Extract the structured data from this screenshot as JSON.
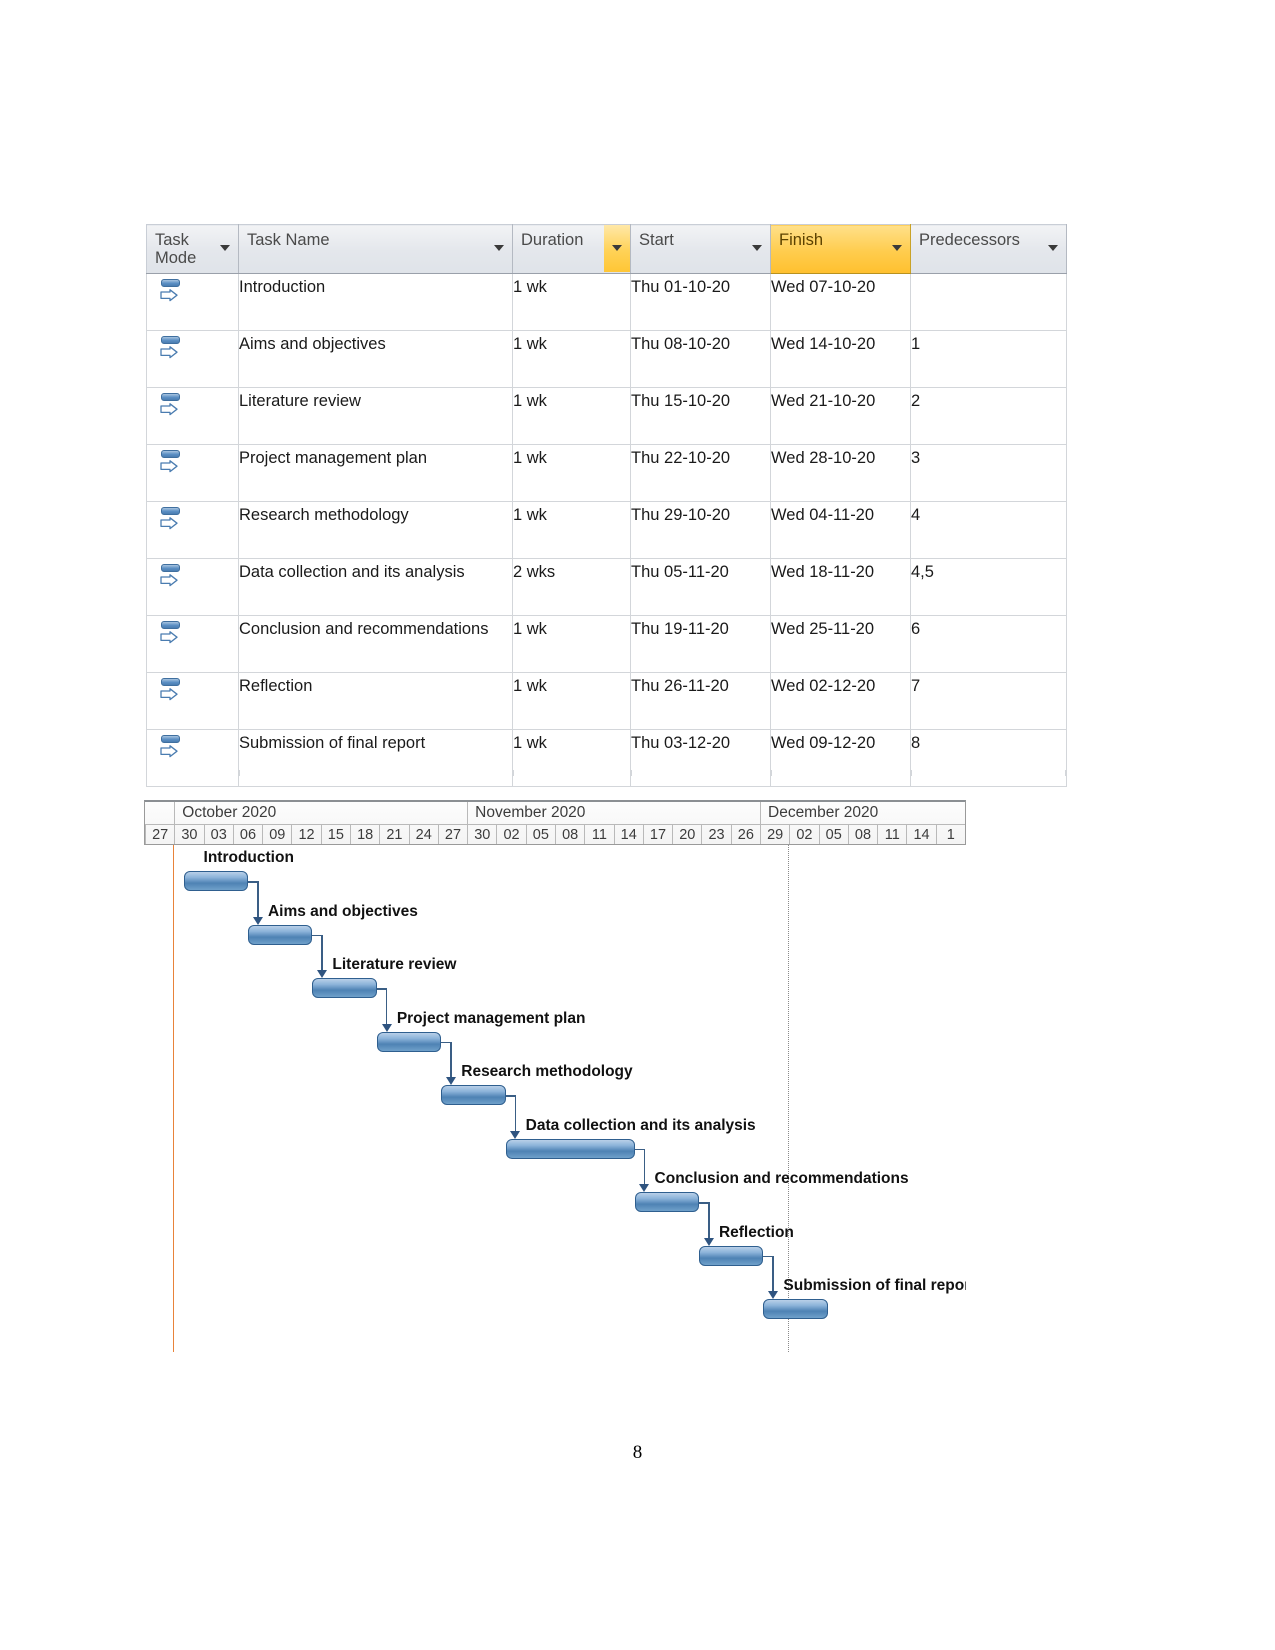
{
  "table": {
    "columns": [
      {
        "key": "mode",
        "label": "Task\nMode",
        "highlight": "none"
      },
      {
        "key": "name",
        "label": "Task Name",
        "highlight": "none"
      },
      {
        "key": "dur",
        "label": "Duration",
        "highlight": "button"
      },
      {
        "key": "start",
        "label": "Start",
        "highlight": "none"
      },
      {
        "key": "finish",
        "label": "Finish",
        "highlight": "full"
      },
      {
        "key": "pred",
        "label": "Predecessors",
        "highlight": "none"
      }
    ],
    "filter_icon": "chevron-down-icon",
    "mode_icon": "auto-scheduled-icon",
    "rows": [
      {
        "name": "Introduction",
        "dur": "1 wk",
        "start": "Thu 01-10-20",
        "finish": "Wed 07-10-20",
        "pred": ""
      },
      {
        "name": "Aims and objectives",
        "dur": "1 wk",
        "start": "Thu 08-10-20",
        "finish": "Wed 14-10-20",
        "pred": "1"
      },
      {
        "name": "Literature review",
        "dur": "1 wk",
        "start": "Thu 15-10-20",
        "finish": "Wed 21-10-20",
        "pred": "2"
      },
      {
        "name": "Project management plan",
        "dur": "1 wk",
        "start": "Thu 22-10-20",
        "finish": "Wed 28-10-20",
        "pred": "3"
      },
      {
        "name": "Research methodology",
        "dur": "1 wk",
        "start": "Thu 29-10-20",
        "finish": "Wed 04-11-20",
        "pred": "4"
      },
      {
        "name": "Data collection and its analysis",
        "dur": "2 wks",
        "start": "Thu 05-11-20",
        "finish": "Wed 18-11-20",
        "pred": "4,5"
      },
      {
        "name": "Conclusion and recommendations",
        "dur": "1 wk",
        "start": "Thu 19-11-20",
        "finish": "Wed 25-11-20",
        "pred": "6"
      },
      {
        "name": "Reflection",
        "dur": "1 wk",
        "start": "Thu 26-11-20",
        "finish": "Wed 02-12-20",
        "pred": "7"
      },
      {
        "name": "Submission of final report",
        "dur": "1 wk",
        "start": "Thu 03-12-20",
        "finish": "Wed 09-12-20",
        "pred": "8"
      }
    ]
  },
  "gantt": {
    "months": [
      {
        "label": "October 2020",
        "start_tick": 1,
        "span": 10
      },
      {
        "label": "November 2020",
        "start_tick": 11,
        "span": 10
      },
      {
        "label": "December 2020",
        "start_tick": 21,
        "span": 5
      }
    ],
    "day_ticks": [
      "27",
      "30",
      "03",
      "06",
      "09",
      "12",
      "15",
      "18",
      "21",
      "24",
      "27",
      "30",
      "02",
      "05",
      "08",
      "11",
      "14",
      "17",
      "20",
      "23",
      "26",
      "29",
      "02",
      "05",
      "08",
      "11",
      "14",
      "1"
    ],
    "today_marker_tick": 1,
    "status_marker_tick": 22,
    "bars": [
      {
        "label": "Introduction",
        "start_tick": 1.35,
        "end_tick": 3.55
      },
      {
        "label": "Aims and objectives",
        "start_tick": 3.55,
        "end_tick": 5.75
      },
      {
        "label": "Literature review",
        "start_tick": 5.75,
        "end_tick": 7.95
      },
      {
        "label": "Project management plan",
        "start_tick": 7.95,
        "end_tick": 10.15
      },
      {
        "label": "Research methodology",
        "start_tick": 10.15,
        "end_tick": 12.35
      },
      {
        "label": "Data collection and its analysis",
        "start_tick": 12.35,
        "end_tick": 16.75
      },
      {
        "label": "Conclusion and recommendations",
        "start_tick": 16.75,
        "end_tick": 18.95
      },
      {
        "label": "Reflection",
        "start_tick": 18.95,
        "end_tick": 21.15
      },
      {
        "label": "Submission of final report",
        "start_tick": 21.15,
        "end_tick": 23.35
      }
    ],
    "colors": {
      "bar_fill": "#4e82b4",
      "bar_border": "#2f5f8f",
      "today_line": "#e8833a",
      "link": "#3a5e85",
      "header_highlight": "#ffcc4d"
    }
  },
  "page": {
    "number": "8"
  }
}
